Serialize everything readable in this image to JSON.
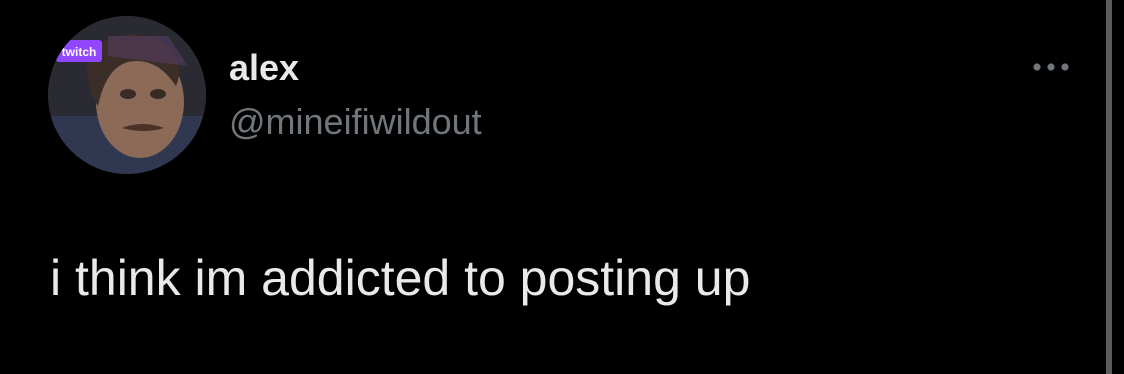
{
  "tweet": {
    "display_name": "alex",
    "handle": "@mineifiwildout",
    "text": "i think im addicted to posting up",
    "avatar_badge": "twitch"
  },
  "icons": {
    "more": "more-horizontal-icon",
    "avatar_badge": "twitch-logo-icon"
  },
  "colors": {
    "background": "#000000",
    "primary_text": "#e7e9ea",
    "secondary_text": "#71767b",
    "twitch_purple": "#9146ff",
    "scrollbar": "#5b5b5b"
  }
}
